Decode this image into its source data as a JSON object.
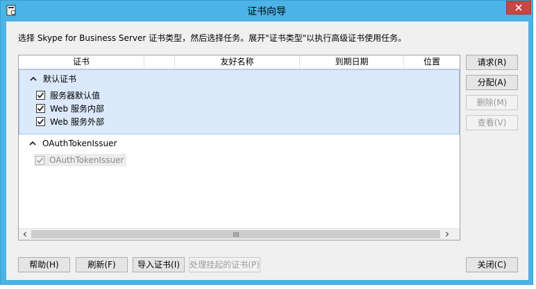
{
  "window": {
    "title": "证书向导"
  },
  "description": "选择 Skype for Business Server 证书类型，然后选择任务。展开\"证书类型\"以执行高级证书使用任务。",
  "columns": [
    "证书",
    "",
    "友好名称",
    "到期日期",
    "位置"
  ],
  "groups": [
    {
      "label": "默认证书",
      "expanded": true,
      "items": [
        {
          "label": "服务器默认值",
          "checked": true
        },
        {
          "label": "Web 服务内部",
          "checked": true
        },
        {
          "label": "Web 服务外部",
          "checked": true
        }
      ]
    },
    {
      "label": "OAuthTokenIssuer",
      "expanded": true,
      "items": [
        {
          "label": "OAuthTokenIssuer",
          "checked": true,
          "disabled": true
        }
      ]
    }
  ],
  "side_buttons": {
    "request": "请求(R)",
    "assign": "分配(A)",
    "remove": "删除(M)",
    "view": "查看(V)"
  },
  "bottom_buttons": {
    "help": "帮助(H)",
    "refresh": "刷新(F)",
    "import": "导入证书(I)",
    "pending": "处理挂起的证书(P)",
    "close": "关闭(C)"
  },
  "colors": {
    "titlebar": "#4bb3e6",
    "close": "#c74646",
    "selection": "#dbe9fb"
  }
}
